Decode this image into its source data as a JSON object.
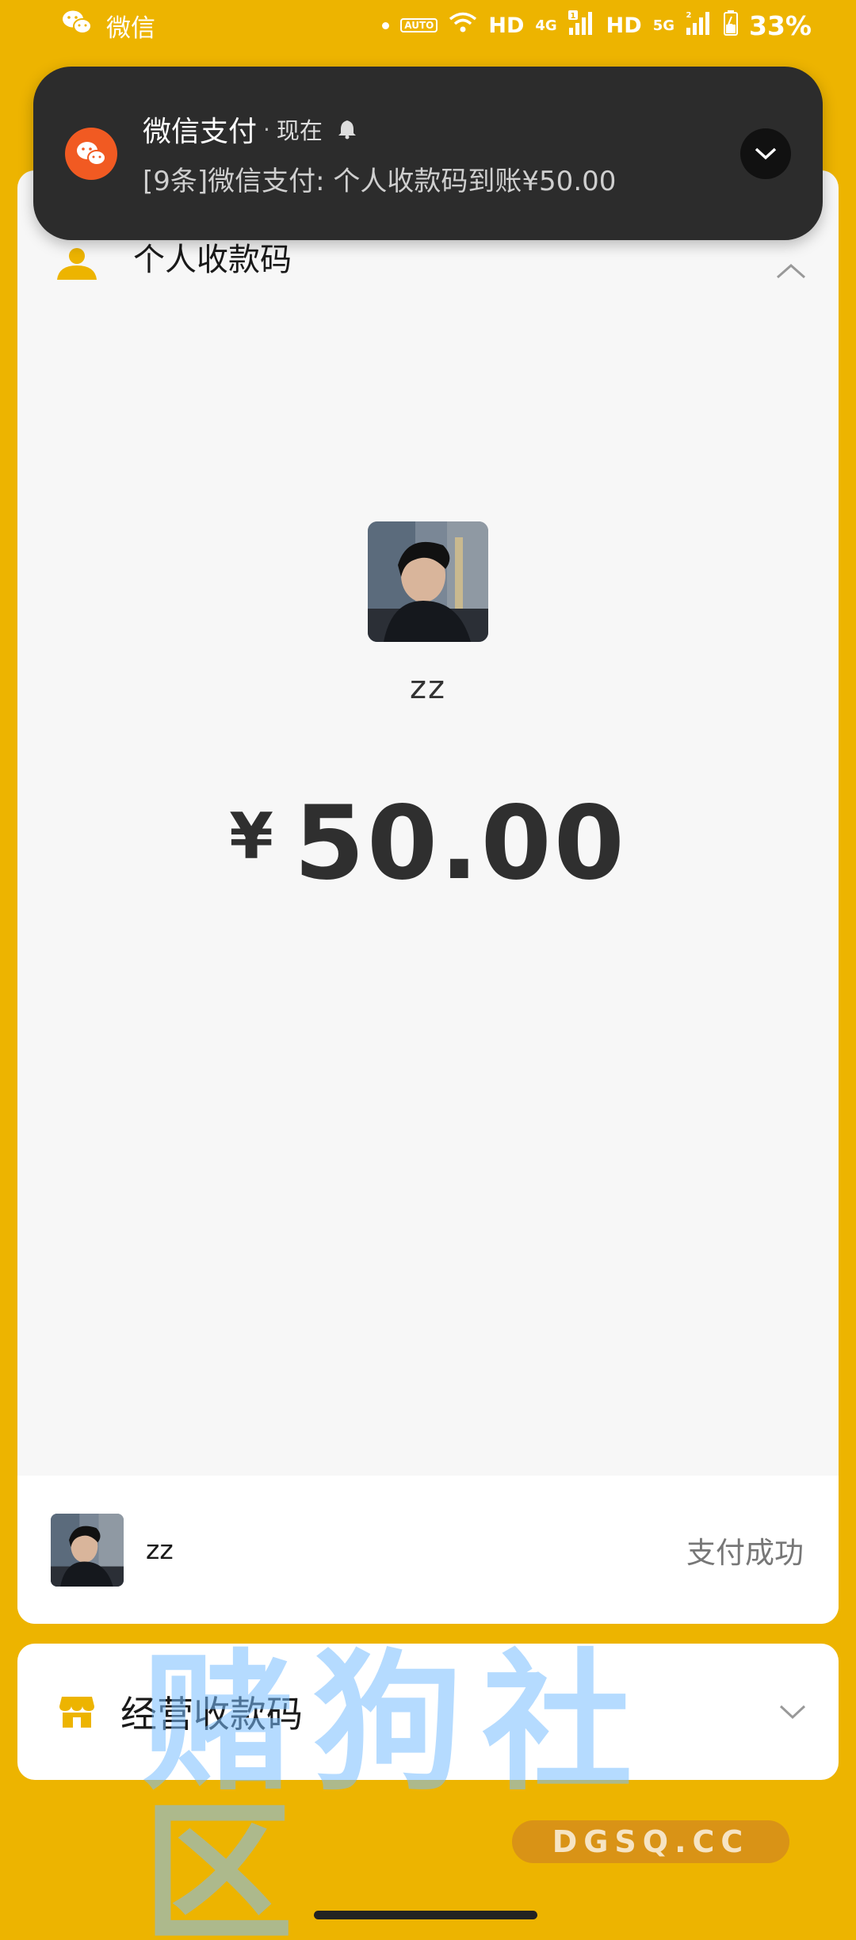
{
  "status_bar": {
    "app": "微信",
    "network_hd1": "HD",
    "network_4g": "4G",
    "network_hd2": "HD",
    "network_5g": "5G",
    "sim1_badge": "1",
    "sim2_badge": "2",
    "auto_label": "AUTO",
    "battery": "33%"
  },
  "notification": {
    "app": "微信支付",
    "separator": "·",
    "time": "现在",
    "body": "[9条]微信支付: 个人收款码到账¥50.00"
  },
  "card": {
    "title": "个人收款码",
    "payer_name": "zz",
    "currency_symbol": "¥",
    "amount": "50.00",
    "result": {
      "name": "zz",
      "status": "支付成功"
    }
  },
  "business_card": {
    "title": "经营收款码"
  },
  "watermark": {
    "text": "赌狗社区",
    "url": "DGSQ.CC"
  },
  "colors": {
    "background": "#EDB400",
    "notification_bg": "#2C2C2C",
    "wechat_icon": "#F15A22"
  }
}
